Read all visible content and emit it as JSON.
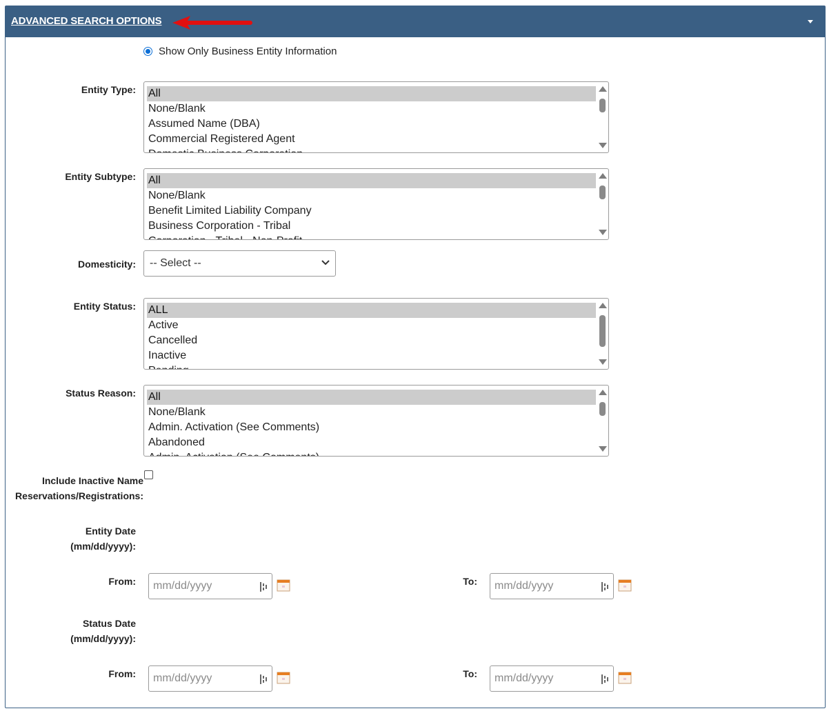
{
  "panel": {
    "title": "ADVANCED SEARCH OPTIONS",
    "header_color": "#3a5f84",
    "annotation_color": "#e11010"
  },
  "radio": {
    "label": "Show Only Business Entity Information",
    "checked": true
  },
  "entity_type": {
    "label": "Entity Type:",
    "options": [
      "All",
      "None/Blank",
      "Assumed Name (DBA)",
      "Commercial Registered Agent",
      "Domestic Business Corporation"
    ],
    "selected": "All"
  },
  "entity_subtype": {
    "label": "Entity Subtype:",
    "options": [
      "All",
      "None/Blank",
      "Benefit Limited Liability Company",
      "Business Corporation - Tribal",
      "Corporation - Tribal - Non-Profit"
    ],
    "selected": "All"
  },
  "domesticity": {
    "label": "Domesticity:",
    "value": "-- Select --"
  },
  "entity_status": {
    "label": "Entity Status:",
    "options": [
      "ALL",
      "Active",
      "Cancelled",
      "Inactive",
      "Pending"
    ],
    "selected": "ALL"
  },
  "status_reason": {
    "label": "Status Reason:",
    "options": [
      "All",
      "None/Blank",
      "Admin. Activation (See Comments)",
      "Abandoned",
      "Admin. Activation (See Comments)"
    ],
    "selected": "All"
  },
  "include_inactive": {
    "label_line1": "Include Inactive Name",
    "label_line2": "Reservations/Registrations:",
    "checked": false
  },
  "entity_date": {
    "label_line1": "Entity Date",
    "label_line2": "(mm/dd/yyyy):",
    "from_label": "From:",
    "to_label": "To:",
    "from_placeholder": "mm/dd/yyyy",
    "to_placeholder": "mm/dd/yyyy"
  },
  "status_date": {
    "label_line1": "Status Date",
    "label_line2": "(mm/dd/yyyy):",
    "from_label": "From:",
    "to_label": "To:",
    "from_placeholder": "mm/dd/yyyy",
    "to_placeholder": "mm/dd/yyyy"
  },
  "icons": {
    "collapse": "caret-down-icon",
    "calendar": "calendar-icon",
    "spinner": "date-spinner-icon",
    "annotation": "red-arrow-icon"
  }
}
